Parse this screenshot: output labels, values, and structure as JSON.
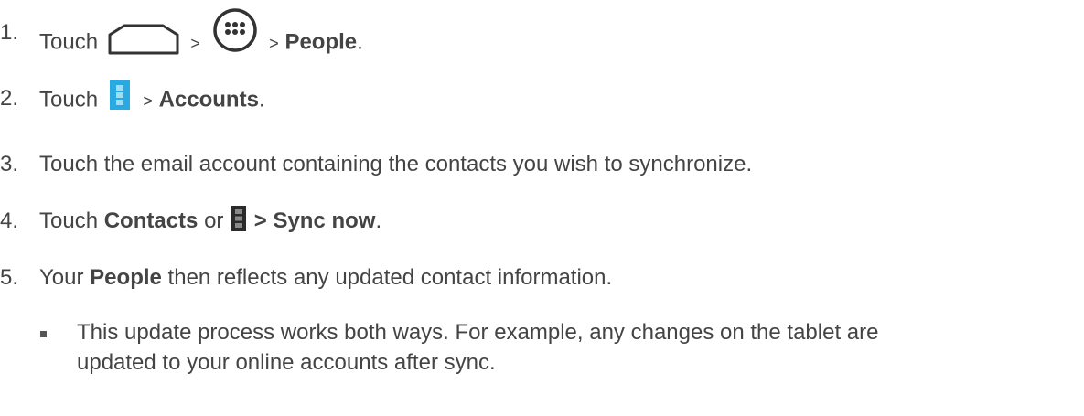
{
  "steps": [
    {
      "num": "1.",
      "pre": "Touch",
      "sep1": ">",
      "sep2": ">",
      "bold": "People",
      "post": "."
    },
    {
      "num": "2.",
      "pre": "Touch",
      "sep1": ">",
      "bold": "Accounts",
      "post": "."
    },
    {
      "num": "3.",
      "text": "Touch the email account containing the contacts you wish to synchronize."
    },
    {
      "num": "4.",
      "pre": "Touch",
      "bold1": "Contacts",
      "mid": "or",
      "bold2": "> Sync now",
      "post": "."
    },
    {
      "num": "5.",
      "pre": "Your",
      "bold": "People",
      "post": "then reflects any updated contact information."
    }
  ],
  "note": {
    "line1": "This update process works both ways. For example, any changes on the tablet are",
    "line2": "updated to your online accounts after sync."
  },
  "icons": {
    "home": "home-icon",
    "apps": "apps-icon",
    "menu_blue": "menu-icon",
    "menu_gray": "menu-icon",
    "menu_blue_color": "#29a9e1"
  }
}
